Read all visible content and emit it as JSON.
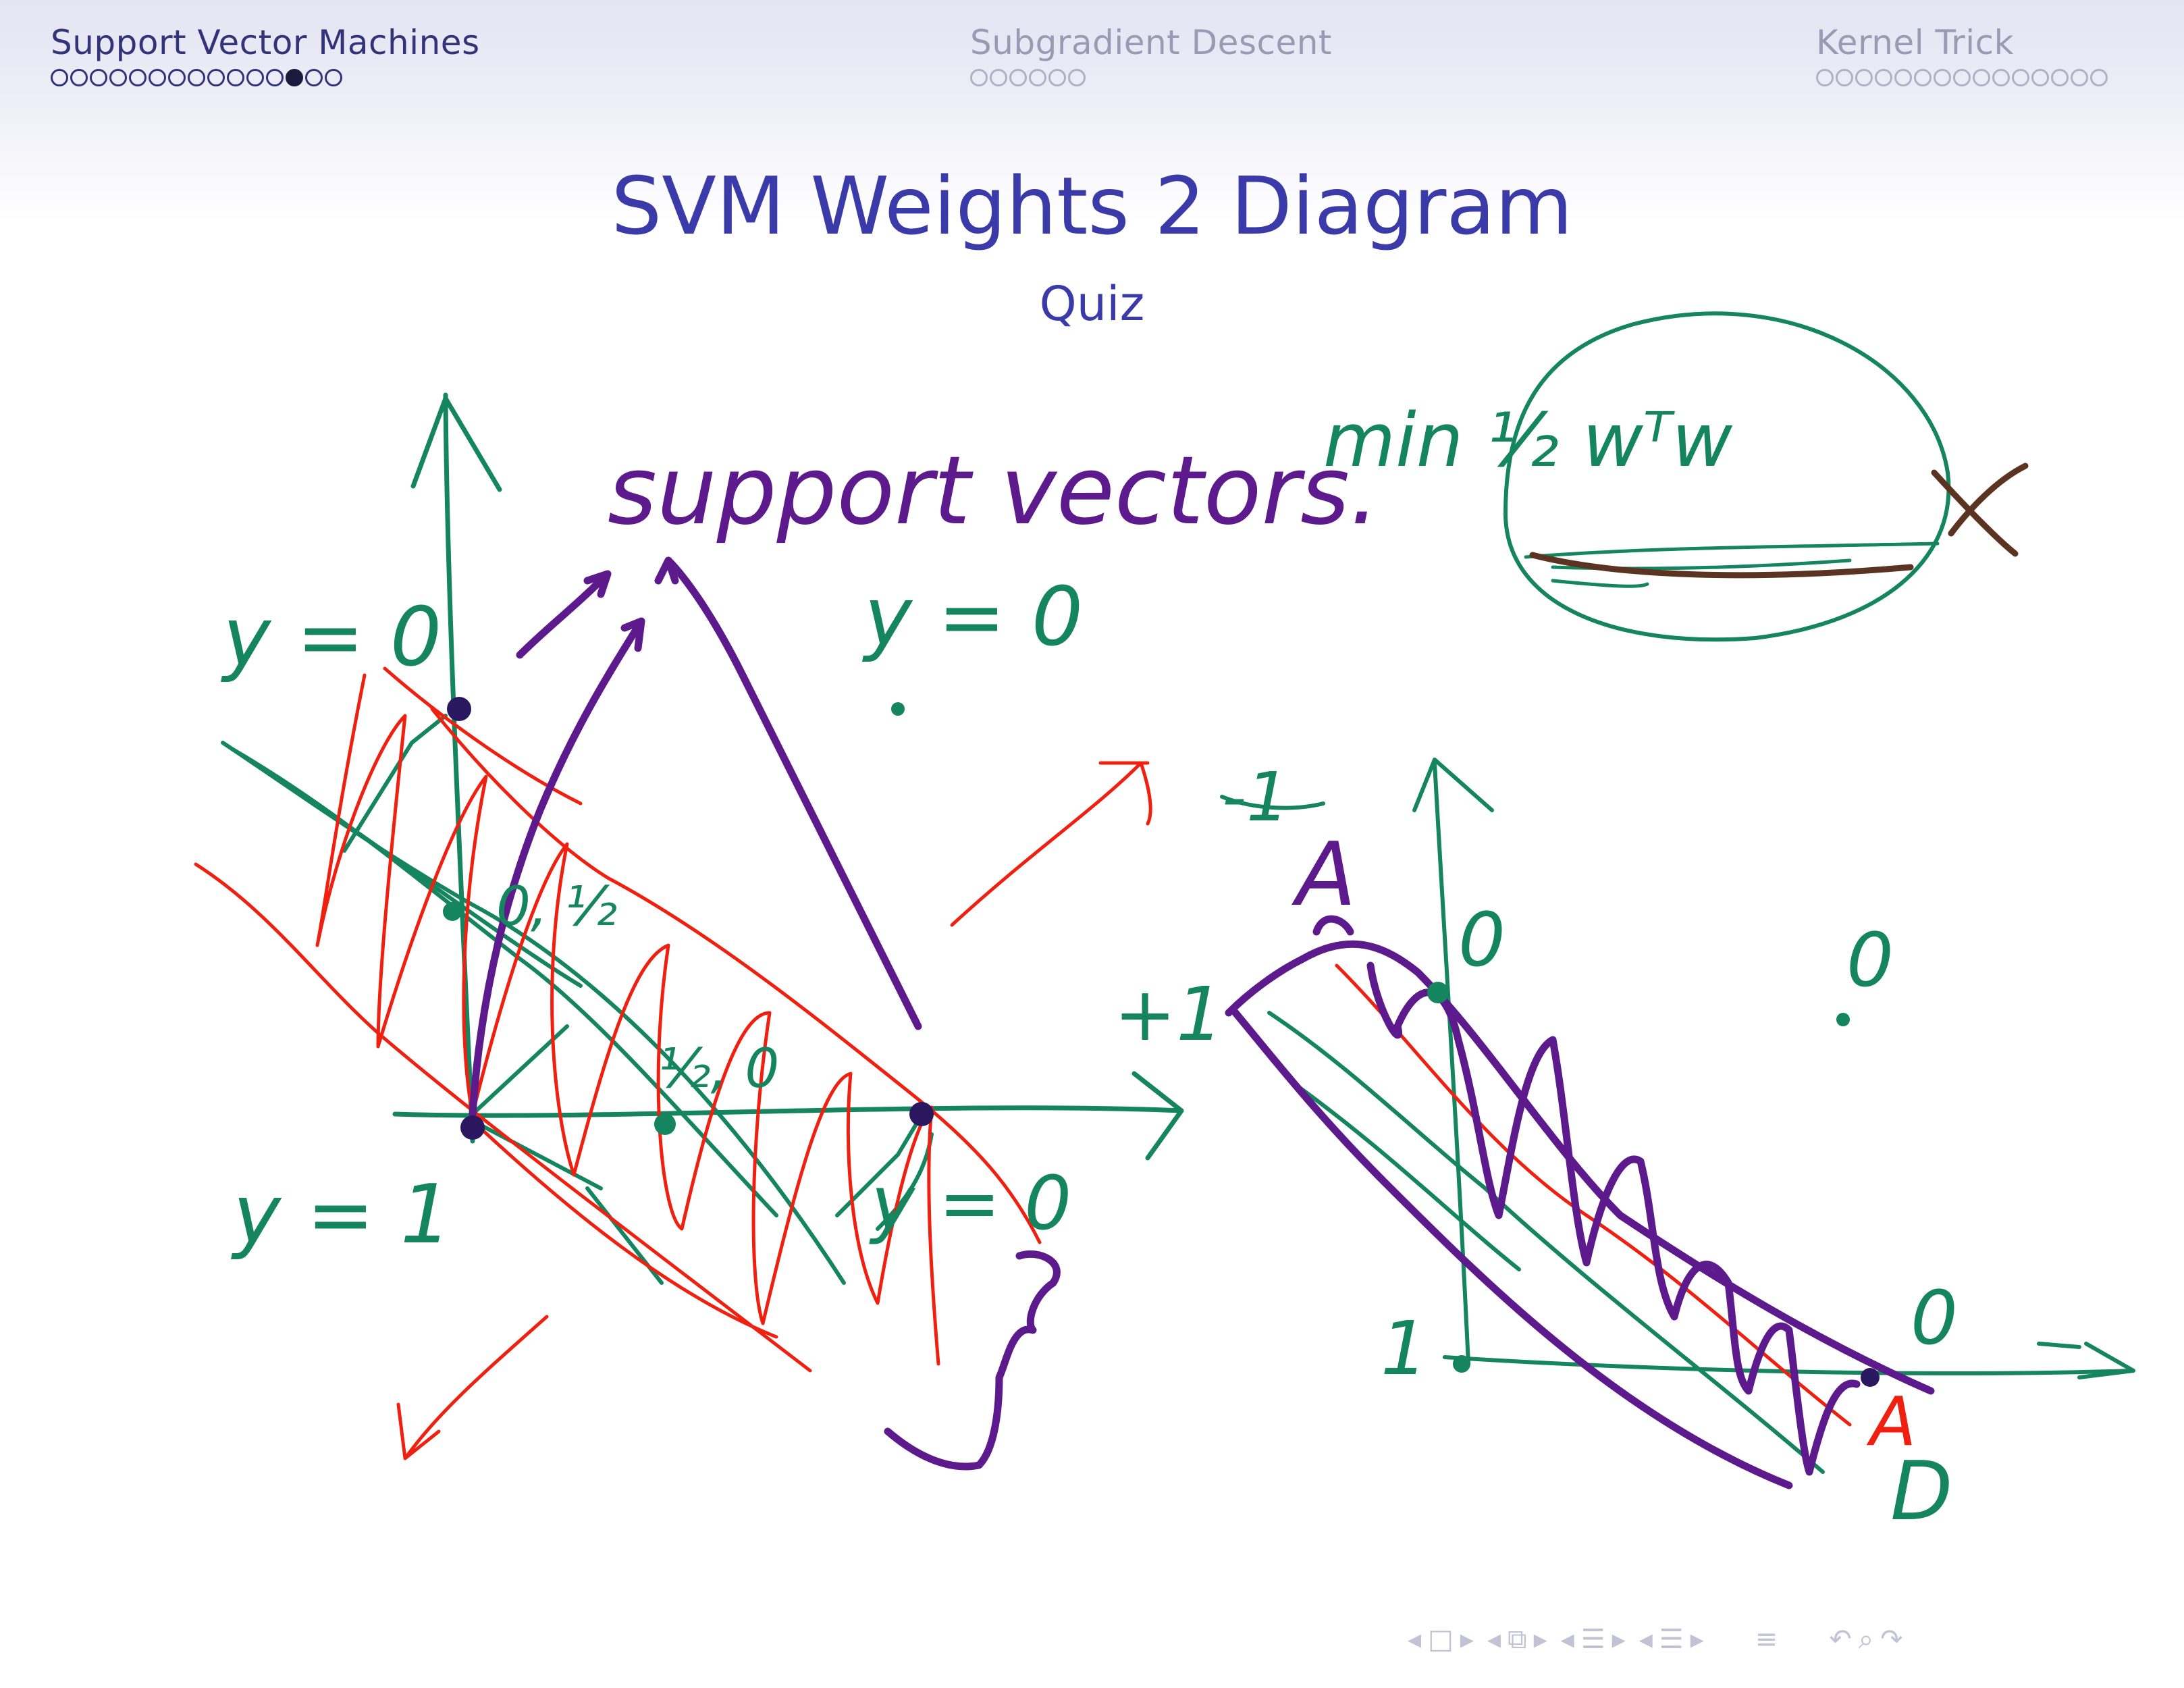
{
  "header": {
    "sections": [
      {
        "label": "Support Vector Machines",
        "dots_total": 15,
        "dots_current": 13
      },
      {
        "label": "Subgradient Descent",
        "dots_total": 6
      },
      {
        "label": "Kernel Trick",
        "dots_total": 15
      }
    ]
  },
  "slide": {
    "title": "SVM Weights 2 Diagram",
    "subtitle": "Quiz"
  },
  "handwriting": {
    "support_vectors": "support vectors.",
    "objective": "min ½ wᵀw",
    "y_eq_0_top": "y = 0",
    "y_eq_0_right": "y = 0",
    "y_eq_1": "y = 1",
    "y_eq_0_bottom": "y = 0",
    "point_0_half": "0, ½",
    "point_half_0": "½, 0",
    "minus_one": "-1",
    "plus_one": "+1",
    "one": "1",
    "zero_top": "0",
    "zero_right": "0",
    "zero_bottom": "0",
    "A_top": "A",
    "A_bottom": "A",
    "D_bottom": "D"
  },
  "colors": {
    "header_active": "#33337a",
    "header_inactive": "#9a9ab4",
    "title": "#3a3aa8",
    "ink_green": "#14855f",
    "ink_purple": "#5c1a8c",
    "ink_red": "#f02010",
    "ink_brown": "#5a3420"
  },
  "navigation": {
    "icons": [
      "nav-prev-frame-icon",
      "nav-frame-icon",
      "nav-next-frame-icon",
      "nav-prev-subsection-icon",
      "nav-subsection-icon",
      "nav-next-subsection-icon",
      "nav-prev-section-icon",
      "nav-section-icon",
      "nav-next-section-icon",
      "nav-prev-slide-icon",
      "nav-slide-icon",
      "nav-next-slide-icon",
      "nav-toc-icon",
      "nav-undo-icon",
      "nav-search-icon",
      "nav-redo-icon"
    ]
  }
}
